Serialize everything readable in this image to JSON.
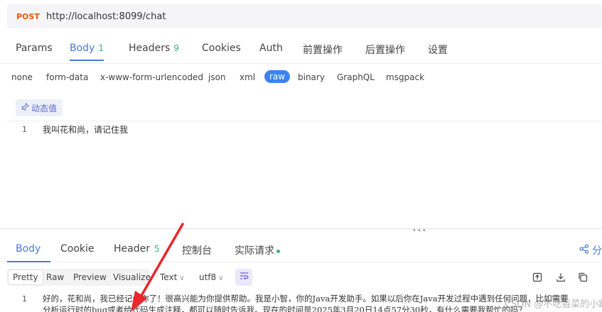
{
  "request": {
    "method": "POST",
    "url": "http://localhost:8099/chat"
  },
  "req_tabs": [
    {
      "label": "Params"
    },
    {
      "label": "Body",
      "count": "1"
    },
    {
      "label": "Headers",
      "count": "9"
    },
    {
      "label": "Cookies"
    },
    {
      "label": "Auth"
    },
    {
      "label": "前置操作"
    },
    {
      "label": "后置操作"
    },
    {
      "label": "设置"
    }
  ],
  "body_types": [
    "none",
    "form-data",
    "x-www-form-urlencoded",
    "json",
    "xml",
    "raw",
    "binary",
    "GraphQL",
    "msgpack"
  ],
  "dynamic_value": "动态值",
  "request_body": {
    "line_number": "1",
    "text": "我叫花和尚，请记住我"
  },
  "resp_tabs": [
    {
      "label": "Body"
    },
    {
      "label": "Cookie"
    },
    {
      "label": "Header",
      "count": "5"
    },
    {
      "label": "控制台"
    },
    {
      "label": "实际请求"
    }
  ],
  "share_label": "分",
  "view_modes": [
    "Pretty",
    "Raw",
    "Preview",
    "Visualize"
  ],
  "format_select": "Text",
  "encoding_select": "utf8",
  "response_body": {
    "line_number": "1",
    "line1": "好的，花和尚，我已经记住你了！很高兴能为你提供帮助。我是小智，你的Java开发助手。如果以后你在Java开发过程中遇到任何问题，比如需要",
    "line2": "分析运行时的bug或者给代码生成注释，都可以随时告诉我。现在的时间是2025年3月20日14点57分30秒，有什么需要我帮忙的吗？"
  },
  "watermark": "CSDN @不吃香菜的小趴菜",
  "colors": {
    "accent": "#4a79d8",
    "method": "#e8590c",
    "count": "#38b27b",
    "raw_pill": "#3b82f6",
    "arrow": "#e8262c"
  },
  "icons": [
    "pin-icon",
    "share-icon",
    "wrap-icon",
    "export-icon",
    "download-icon",
    "copy-icon"
  ]
}
